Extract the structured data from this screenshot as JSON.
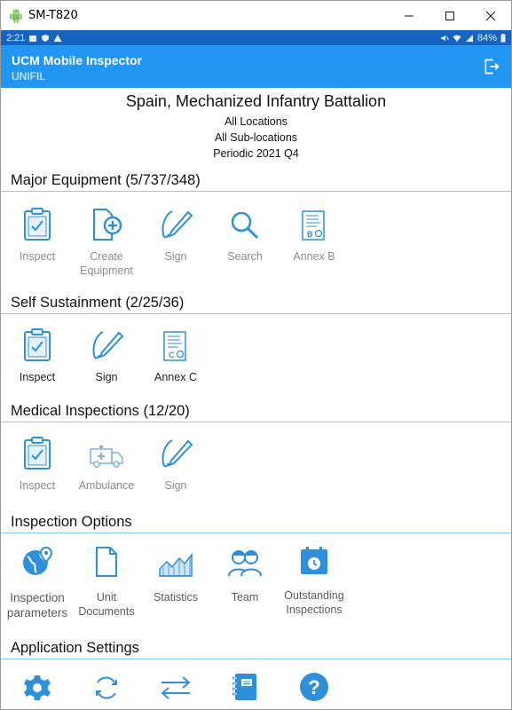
{
  "window": {
    "title": "SM-T820"
  },
  "status_bar": {
    "time": "2:21",
    "battery": "84%"
  },
  "app_bar": {
    "title": "UCM Mobile Inspector",
    "subtitle": "UNIFIL"
  },
  "header": {
    "unit": "Spain, Mechanized Infantry Battalion",
    "location": "All Locations",
    "sublocation": "All Sub-locations",
    "period": "Periodic 2021 Q4"
  },
  "sections": {
    "major": {
      "title": "Major Equipment (5/737/348)",
      "items": [
        "Inspect",
        "Create Equipment",
        "Sign",
        "Search",
        "Annex B"
      ]
    },
    "self": {
      "title": "Self Sustainment (2/25/36)",
      "items": [
        "Inspect",
        "Sign",
        "Annex C"
      ]
    },
    "medical": {
      "title": "Medical Inspections (12/20)",
      "items": [
        "Inspect",
        "Ambulance",
        "Sign"
      ]
    },
    "options": {
      "title": "Inspection Options",
      "items": [
        "Inspection parameters",
        "Unit Documents",
        "Statistics",
        "Team",
        "Outstanding Inspections"
      ]
    },
    "settings": {
      "title": "Application Settings",
      "items": [
        "settings-gear",
        "refresh",
        "transfer",
        "notebook",
        "help"
      ]
    }
  },
  "colors": {
    "accent": "#2196f3",
    "statusbar": "#1565c0",
    "icon": "#2f8fd8",
    "divider": "#8ec9f2"
  }
}
